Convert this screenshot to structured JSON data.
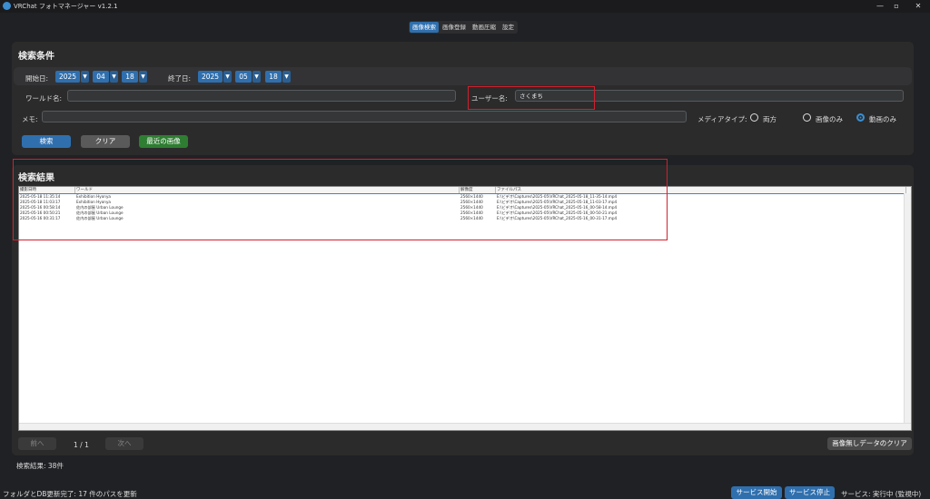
{
  "window": {
    "title": "VRChat フォトマネージャー v1.2.1",
    "minimize": "—",
    "maximize": "▫",
    "close": "✕"
  },
  "tabs": [
    {
      "label": "画像検索",
      "active": true
    },
    {
      "label": "画像登録",
      "active": false
    },
    {
      "label": "動画圧縮",
      "active": false
    },
    {
      "label": "設定",
      "active": false
    }
  ],
  "search": {
    "title": "検索条件",
    "start_label": "開始日:",
    "start_year": "2025",
    "start_month": "04",
    "start_day": "18",
    "end_label": "終了日:",
    "end_year": "2025",
    "end_month": "05",
    "end_day": "18",
    "world_label": "ワールド名:",
    "world_value": "",
    "user_label": "ユーザー名:",
    "user_value": "さくまち",
    "memo_label": "メモ:",
    "memo_value": "",
    "media_label": "メディアタイプ:",
    "media_options": [
      "両方",
      "画像のみ",
      "動画のみ"
    ],
    "media_selected": "動画のみ",
    "search_button": "検索",
    "clear_button": "クリア",
    "recent_button": "最近の画像"
  },
  "results": {
    "title": "検索結果",
    "columns": [
      "撮影日時",
      "ワールド",
      "解像度",
      "ファイルパス"
    ],
    "rows": [
      [
        "2025-05-18 11:35:14",
        "Exhibition Hyonya",
        "2560×1440",
        "E:\\ビデオ\\Captures\\2025-05\\VRChat_2025-05-18_11-35-14.mp4"
      ],
      [
        "2025-05-18 11:03:17",
        "Exhibition Hyonya",
        "2560×1440",
        "E:\\ビデオ\\Captures\\2025-05\\VRChat_2025-05-18_11-03-17.mp4"
      ],
      [
        "2025-05-16 00:58:14",
        "佐内の部屋 Urban Lounge",
        "2560×1440",
        "E:\\ビデオ\\Captures\\2025-05\\VRChat_2025-05-16_00-58-14.mp4"
      ],
      [
        "2025-05-16 00:50:21",
        "佐内の部屋 Urban Lounge",
        "2560×1440",
        "E:\\ビデオ\\Captures\\2025-05\\VRChat_2025-05-16_00-50-21.mp4"
      ],
      [
        "2025-05-16 00:31:17",
        "佐内の部屋 Urban Lounge",
        "2560×1440",
        "E:\\ビデオ\\Captures\\2025-05\\VRChat_2025-05-16_00-31-17.mp4"
      ]
    ],
    "prev_button": "前へ",
    "page_indicator": "1 / 1",
    "next_button": "次へ",
    "clear_missing_button": "画像無しデータのクリア",
    "count_text": "検索結果: 38件"
  },
  "status": {
    "left_text": "フォルダとDB更新完了: 17 件のパスを更新",
    "service_start": "サービス開始",
    "service_stop": "サービス停止",
    "service_status": "サービス: 実行中 (監視中)"
  },
  "colors": {
    "accent": "#2f6fae",
    "recent_button": "#2e7d32",
    "clear_button": "#5a5a5a",
    "highlight": "#d0212e"
  }
}
